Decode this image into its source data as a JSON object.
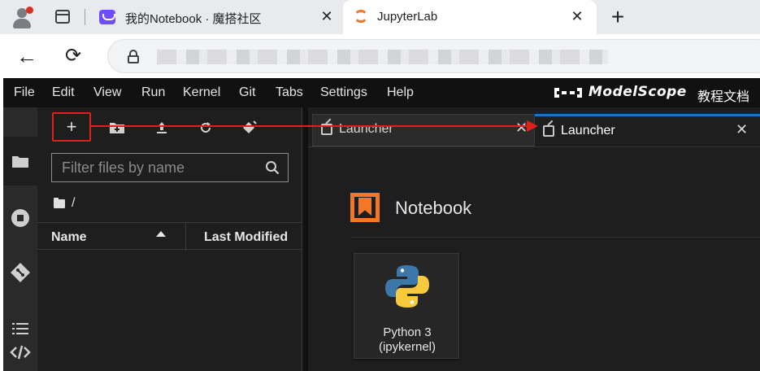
{
  "browser": {
    "tabs": [
      {
        "title": "我的Notebook · 魔搭社区",
        "favicon": "modelscope-icon"
      },
      {
        "title": "JupyterLab",
        "favicon": "jupyter-icon",
        "active": true
      }
    ],
    "new_tab_label": "+",
    "close_label": "✕",
    "back_label": "←",
    "reload_label": "⟳",
    "address_blurred": true
  },
  "jupyterlab": {
    "menu": [
      "File",
      "Edit",
      "View",
      "Run",
      "Kernel",
      "Git",
      "Tabs",
      "Settings",
      "Help"
    ],
    "brand_name": "ModelScope",
    "docs_link": "教程文档",
    "filebrowser": {
      "new_launcher_label": "+",
      "filter_placeholder": "Filter files by name",
      "breadcrumb": "/",
      "columns": {
        "name": "Name",
        "modified": "Last Modified"
      },
      "sort": "ascending"
    },
    "doc_tabs": [
      {
        "label": "Launcher",
        "close": "✕",
        "active": false
      },
      {
        "label": "Launcher",
        "close": "✕",
        "active": true
      }
    ],
    "launcher": {
      "section": "Notebook",
      "kernel_label_line1": "Python 3",
      "kernel_label_line2": "(ipykernel)"
    }
  },
  "colors": {
    "accent_blue": "#1a73c8",
    "annotation_red": "#e0201b",
    "jupyter_orange": "#f37726"
  }
}
